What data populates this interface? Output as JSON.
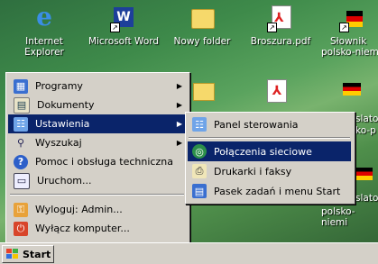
{
  "desktop": {
    "icons": [
      {
        "label1": "Internet",
        "label2": "Explorer"
      },
      {
        "label1": "Microsoft Word",
        "label2": ""
      },
      {
        "label1": "Nowy folder",
        "label2": ""
      },
      {
        "label1": "Broszura.pdf",
        "label2": ""
      },
      {
        "label1": "Słownik",
        "label2": "polsko-niem"
      }
    ],
    "partial_labels": [
      "slato",
      "ko-p",
      "slato",
      "polsko-niemi"
    ]
  },
  "start_menu": {
    "items": [
      {
        "label": "Programy",
        "icon": "programs-icon",
        "has_submenu": true
      },
      {
        "label": "Dokumenty",
        "icon": "documents-icon",
        "has_submenu": true
      },
      {
        "label": "Ustawienia",
        "icon": "settings-icon",
        "has_submenu": true,
        "selected": true
      },
      {
        "label": "Wyszukaj",
        "icon": "search-icon",
        "has_submenu": true
      },
      {
        "label": "Pomoc i obsługa techniczna",
        "icon": "help-icon"
      },
      {
        "label": "Uruchom...",
        "icon": "run-icon"
      },
      {
        "label": "Wyloguj: Admin...",
        "icon": "logoff-icon"
      },
      {
        "label": "Wyłącz komputer...",
        "icon": "shutdown-icon"
      }
    ]
  },
  "settings_submenu": {
    "items": [
      {
        "label": "Panel sterowania",
        "icon": "control-panel-icon"
      },
      {
        "label": "Połączenia sieciowe",
        "icon": "network-icon",
        "selected": true
      },
      {
        "label": "Drukarki i faksy",
        "icon": "printer-icon"
      },
      {
        "label": "Pasek zadań i menu Start",
        "icon": "taskbar-icon"
      }
    ]
  },
  "taskbar": {
    "start_label": "Start"
  },
  "colors": {
    "selection": "#0a246a",
    "menu_bg": "#d4d0c8"
  }
}
